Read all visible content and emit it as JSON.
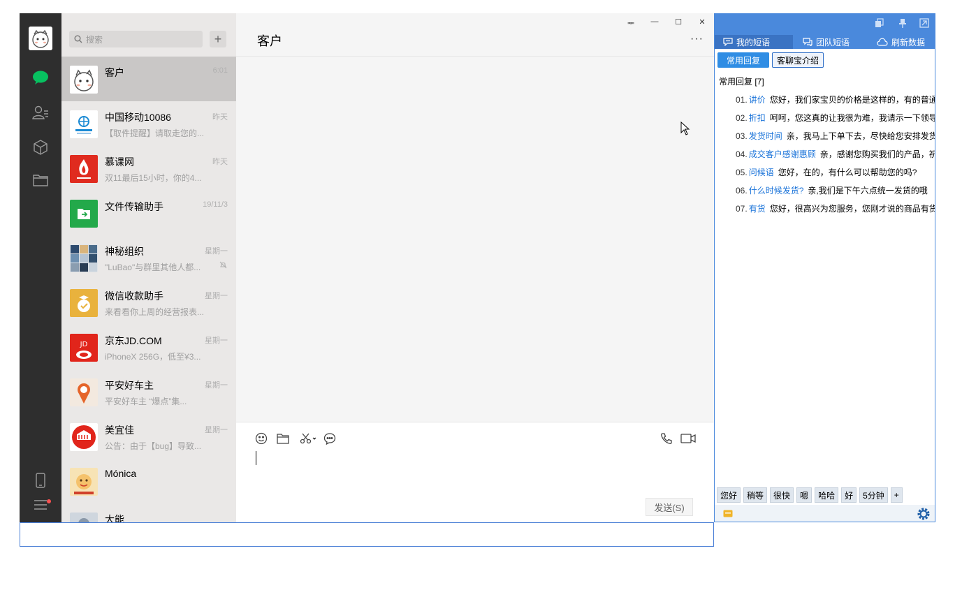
{
  "wechat": {
    "search_placeholder": "搜索",
    "add_label": "+",
    "conversations": [
      {
        "name": "客户",
        "time": "6:01",
        "preview": "",
        "muted": false
      },
      {
        "name": "中国移动10086",
        "time": "昨天",
        "preview": "【取件提醒】请取走您的...",
        "muted": false
      },
      {
        "name": "慕课网",
        "time": "昨天",
        "preview": "双11最后15小时，你的4...",
        "muted": false
      },
      {
        "name": "文件传输助手",
        "time": "19/11/3",
        "preview": "",
        "muted": false
      },
      {
        "name": "神秘组织",
        "time": "星期一",
        "preview": "\"LuBao\"与群里其他人都...",
        "muted": true
      },
      {
        "name": "微信收款助手",
        "time": "星期一",
        "preview": "来看看你上周的经营报表...",
        "muted": false
      },
      {
        "name": "京东JD.COM",
        "time": "星期一",
        "preview": "iPhoneX 256G，低至¥3...",
        "muted": false
      },
      {
        "name": "平安好车主",
        "time": "星期一",
        "preview": "平安好车主 “爆点”集...",
        "muted": false
      },
      {
        "name": "美宜佳",
        "time": "星期一",
        "preview": "公告：由于【bug】导致...",
        "muted": false
      },
      {
        "name": "Mónica",
        "time": "",
        "preview": "",
        "muted": false
      },
      {
        "name": "大能",
        "time": "",
        "preview": "",
        "muted": false
      }
    ],
    "chat": {
      "title": "客户",
      "more": "···",
      "pin": "ᆓ",
      "minimize": "—",
      "maximize": "☐",
      "close": "✕",
      "send_label": "发送(S)"
    }
  },
  "panel": {
    "tabs": [
      {
        "label": "我的短语",
        "icon": "chat-bubble-icon",
        "active": true
      },
      {
        "label": "团队短语",
        "icon": "team-chat-icon",
        "active": false
      },
      {
        "label": "刷新数据",
        "icon": "cloud-icon",
        "active": false
      }
    ],
    "buttons": {
      "common": "常用回复",
      "intro": "客聊宝介绍"
    },
    "group_label": "常用回复 [7]",
    "replies": [
      {
        "num": "01.",
        "key": "讲价",
        "text": "您好，我们家宝贝的价格是这样的，有的普通"
      },
      {
        "num": "02.",
        "key": "折扣",
        "text": "呵呵，您这真的让我很为难，我请示一下领导"
      },
      {
        "num": "03.",
        "key": "发货时间",
        "text": "亲，我马上下单下去，尽快给您安排发货"
      },
      {
        "num": "04.",
        "key": "成交客户感谢惠顾",
        "text": "亲，感谢您购买我们的产品，祝"
      },
      {
        "num": "05.",
        "key": "问候语",
        "text": "您好，在的，有什么可以帮助您的吗?"
      },
      {
        "num": "06.",
        "key": "什么时候发货?",
        "text": "亲,我们是下午六点统一发货的哦"
      },
      {
        "num": "07.",
        "key": "有货",
        "text": "您好，很高兴为您服务，您刚才说的商品有货"
      }
    ],
    "quick": [
      "您好",
      "稍等",
      "很快",
      "嗯",
      "哈哈",
      "好",
      "5分钟",
      "+"
    ]
  }
}
